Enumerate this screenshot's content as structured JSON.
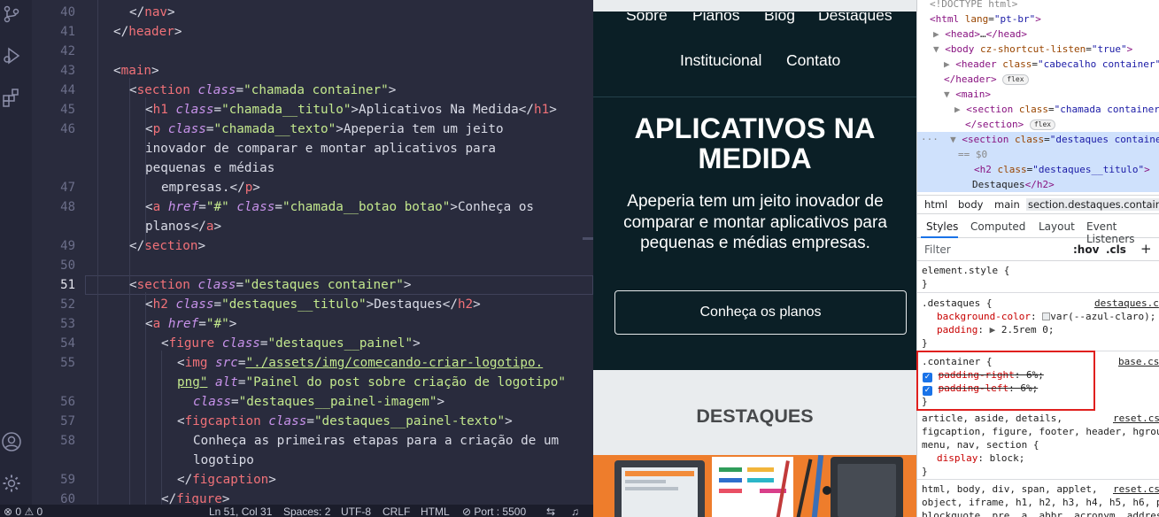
{
  "editor": {
    "lines": [
      {
        "n": "40",
        "active": false
      },
      {
        "n": "41",
        "active": false
      },
      {
        "n": "42",
        "active": false
      },
      {
        "n": "43",
        "active": false
      },
      {
        "n": "44",
        "active": false
      },
      {
        "n": "45",
        "active": false
      },
      {
        "n": "46",
        "active": false
      },
      {
        "n": "47",
        "active": false
      },
      {
        "n": "48",
        "active": false
      },
      {
        "n": "49",
        "active": false
      },
      {
        "n": "50",
        "active": false
      },
      {
        "n": "51",
        "active": true
      },
      {
        "n": "52",
        "active": false
      },
      {
        "n": "53",
        "active": false
      },
      {
        "n": "54",
        "active": false
      },
      {
        "n": "55",
        "active": false
      },
      {
        "n": "56",
        "active": false
      },
      {
        "n": "57",
        "active": false
      },
      {
        "n": "58",
        "active": false
      },
      {
        "n": "59",
        "active": false
      },
      {
        "n": "60",
        "active": false
      }
    ],
    "code": {
      "l40": "nav",
      "l41": "header",
      "l43": "main",
      "section": "section",
      "class": "class",
      "h1": "h1",
      "p": "p",
      "a": "a",
      "href": "href",
      "h2": "h2",
      "figure": "figure",
      "img": "img",
      "src": "src",
      "alt": "alt",
      "figcaption": "figcaption",
      "v_chamada_container": "\"chamada container\"",
      "v_chamada_titulo": "\"chamada__titulo\"",
      "t_h1": "Aplicativos Na Medida",
      "v_chamada_texto": "\"chamada__texto\"",
      "t_p1": "Apeperia tem um jeito",
      "t_p2": "inovador de comparar e montar aplicativos para",
      "t_p3": "pequenas e médias",
      "t_p4": "empresas.",
      "v_hash": "\"#\"",
      "v_chamada_botao": "\"chamada__botao botao\"",
      "t_a1": "Conheça os",
      "t_a2": "planos",
      "v_destaques_container": "\"destaques container\"",
      "v_destaques_titulo": "\"destaques__titulo\"",
      "t_h2": "Destaques",
      "v_destaques_painel": "\"destaques__painel\"",
      "v_img_src_1": "\"./assets/img/comecando-criar-logotipo.",
      "v_img_src_2": "png\"",
      "v_img_alt": "\"Painel do post sobre criação de logotipo\"",
      "v_painel_imagem": "\"destaques__painel-imagem\"",
      "v_painel_texto": "\"destaques__painel-texto\"",
      "t_fig1": "Conheça as primeiras etapas para a criação de um",
      "t_fig2": "logotipo"
    }
  },
  "statusbar": {
    "problems": "0",
    "warnings": "0",
    "position": "Ln 51, Col 31",
    "spaces": "Spaces: 2",
    "encoding": "UTF-8",
    "eol": "CRLF",
    "language": "HTML",
    "port": "Port : 5500"
  },
  "preview": {
    "nav_top_cut": [
      "Sobre",
      "Planos",
      "Blog",
      "Destaques"
    ],
    "nav_links": [
      "Institucional",
      "Contato"
    ],
    "hero_title": "APLICATIVOS NA MEDIDA",
    "hero_text": "Apeperia tem um jeito inovador de comparar e montar aplicativos para pequenas e médias empresas.",
    "hero_button": "Conheça os planos",
    "destaques_title": "DESTAQUES"
  },
  "devtools": {
    "dom": {
      "doctype": "<!DOCTYPE html>",
      "html_tag": "html",
      "lang_attr": "lang",
      "lang_val": "\"pt-br\"",
      "head": "head",
      "body": "body",
      "body_attr": "cz-shortcut-listen",
      "body_val": "\"true\"",
      "header": "header",
      "class": "class",
      "header_class": "\"cabecalho container\"",
      "header_close": "header",
      "flex": "flex",
      "main": "main",
      "section": "section",
      "section_chamada": "\"chamada container\"",
      "section_close": "section",
      "section_destaques": "\"destaques container\"",
      "eq0": "== $0",
      "h2": "h2",
      "h2_class": "\"destaques__titulo\"",
      "h2_text": "Destaques",
      "dots": "…"
    },
    "breadcrumbs": [
      "html",
      "body",
      "main",
      "section.destaques.container"
    ],
    "tabs": [
      "Styles",
      "Computed",
      "Layout",
      "Event Listeners"
    ],
    "filter_placeholder": "Filter",
    "hov": ":hov",
    "cls": ".cls",
    "plus": "+",
    "rules": {
      "element_style": "element.style {",
      "close": "}",
      "destaques_selector": ".destaques {",
      "destaques_source": "destaques.c",
      "bg_prop": "background-color",
      "bg_val": "var(--azul-claro);",
      "pad_prop": "padding",
      "pad_val": "2.5rem 0;",
      "container_selector": ".container {",
      "container_source": "base.cs",
      "pr_prop": "padding-right",
      "pr_val": "6%;",
      "pl_prop": "padding-left",
      "pl_val": "6%;",
      "reset_selector_1": "article, aside, details,",
      "reset_selector_2": "figcaption, figure, footer, header, hgrou",
      "reset_selector_3": "menu, nav, section {",
      "reset_source": "reset.cs",
      "display_prop": "display",
      "display_val": "block;",
      "reset2_selector_1": "html, body, div, span, applet,",
      "reset2_selector_2": "object, iframe, h1, h2, h3, h4, h5, h6, p",
      "reset2_selector_3": "blockquote, pre, a, abbr, acronym, addres"
    }
  },
  "colors": {
    "editor_bg": "#292b3d",
    "preview_dark": "#0b1f26",
    "highlight_box": "#e0201e",
    "tag": "#f07178",
    "attr": "#c792ea",
    "string": "#c3e88d"
  }
}
